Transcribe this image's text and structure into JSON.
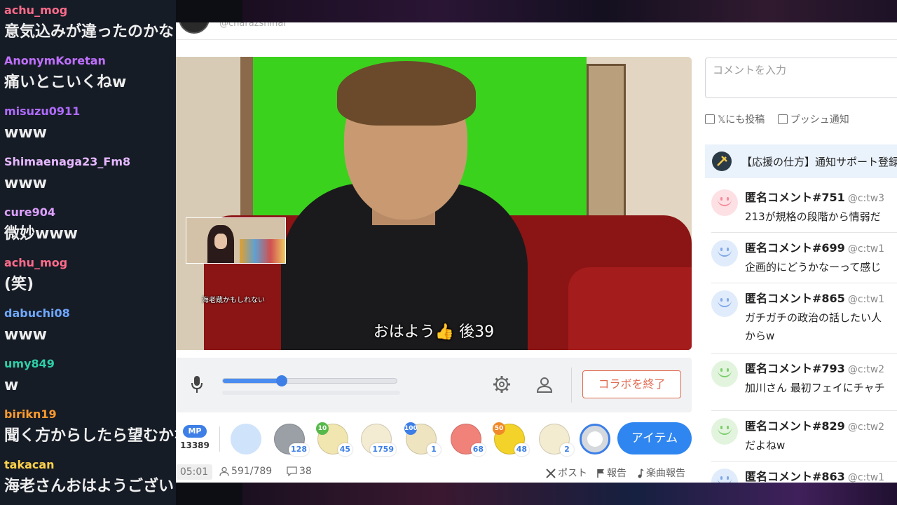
{
  "overlay_chat": [
    {
      "user": "achu_mog",
      "color": "#ff6b8a",
      "text": "意気込みが違ったのかな"
    },
    {
      "user": "AnonymKoretan",
      "color": "#c070ff",
      "text": "痛いとこいくねw"
    },
    {
      "user": "misuzu0911",
      "color": "#b06bff",
      "text": "www"
    },
    {
      "user": "Shimaenaga23_Fm8",
      "color": "#e6b8ff",
      "text": "www"
    },
    {
      "user": "cure904",
      "color": "#dda0ff",
      "text": "微妙www"
    },
    {
      "user": "achu_mog",
      "color": "#ff6b8a",
      "text": "(笑)"
    },
    {
      "user": "dabuchi08",
      "color": "#6fa8ff",
      "text": "www"
    },
    {
      "user": "umy849",
      "color": "#2ecfa8",
      "text": "w"
    },
    {
      "user": "birikn19",
      "color": "#ff9a2e",
      "text": "聞く方からしたら望むかな"
    },
    {
      "user": "takacan",
      "color": "#ffd24a",
      "text": "海老さんおはようございます"
    }
  ],
  "header": {
    "handle": "@charazshinai"
  },
  "video": {
    "pip_caption": "海老蔵かもしれない",
    "caption": "おはよう👍 後39"
  },
  "controls": {
    "volume_fraction": 0.34,
    "end_collab_label": "コラボを終了"
  },
  "items": {
    "mp_label": "MP",
    "mp_value": "13389",
    "list": [
      {
        "name": "smile-item",
        "color": "#cfe3fb",
        "count": ""
      },
      {
        "name": "coin-item",
        "color": "#9aa0a6",
        "count": "128"
      },
      {
        "name": "onigiri-item",
        "color": "#f2e6b0",
        "count": "45",
        "level": "10",
        "level_color": "#56b94a"
      },
      {
        "name": "bun-item",
        "color": "#f4ecd2",
        "count": "1759"
      },
      {
        "name": "onigiri-item-2",
        "color": "#efe4c0",
        "count": "1",
        "level": "100",
        "level_color": "#3d7fe6"
      },
      {
        "name": "pink-blob-item",
        "color": "#f0827a",
        "count": "68"
      },
      {
        "name": "yellow-bird-item",
        "color": "#f3d22a",
        "count": "48",
        "level": "50",
        "level_color": "#f08a2a"
      },
      {
        "name": "scroll-item",
        "color": "#f4ecd0",
        "count": "2"
      },
      {
        "name": "coin-ring-item",
        "color": "#3d7fe6",
        "count": ""
      }
    ],
    "item_button_label": "アイテム"
  },
  "footer": {
    "time": "05:01",
    "viewers": "591/789",
    "comments": "38",
    "post_label": "ポスト",
    "report_label": "報告",
    "music_report_label": "楽曲報告"
  },
  "comment_input": {
    "placeholder": "コメントを入力"
  },
  "checkboxes": {
    "x_post": "𝕏にも投稿",
    "push": "プッシュ通知"
  },
  "notice": {
    "text": "【応援の仕方】通知サポート登録"
  },
  "comments": [
    {
      "name": "匿名コメント#751",
      "id": "@c:tw3",
      "avatar_color": "#fde0e4",
      "smile_color": "#f58a9c",
      "lines": [
        "213が規格の段階から情弱だ"
      ]
    },
    {
      "name": "匿名コメント#699",
      "id": "@c:tw1",
      "avatar_color": "#e0ecfb",
      "smile_color": "#7fa8e6",
      "lines": [
        "企画的にどうかなーって感じ"
      ]
    },
    {
      "name": "匿名コメント#865",
      "id": "@c:tw1",
      "avatar_color": "#e0ecfb",
      "smile_color": "#7fa8e6",
      "lines": [
        "ガチガチの政治の話したい人",
        "からw"
      ]
    },
    {
      "name": "匿名コメント#793",
      "id": "@c:tw2",
      "avatar_color": "#e2f4de",
      "smile_color": "#7ccd6c",
      "lines": [
        "加川さん 最初フェイにチャチ"
      ]
    },
    {
      "name": "匿名コメント#829",
      "id": "@c:tw2",
      "avatar_color": "#e2f4de",
      "smile_color": "#7ccd6c",
      "lines": [
        "だよねw"
      ]
    },
    {
      "name": "匿名コメント#863",
      "id": "@c:tw1",
      "avatar_color": "#e0ecfb",
      "smile_color": "#7fa8e6",
      "lines": [
        ""
      ]
    }
  ]
}
